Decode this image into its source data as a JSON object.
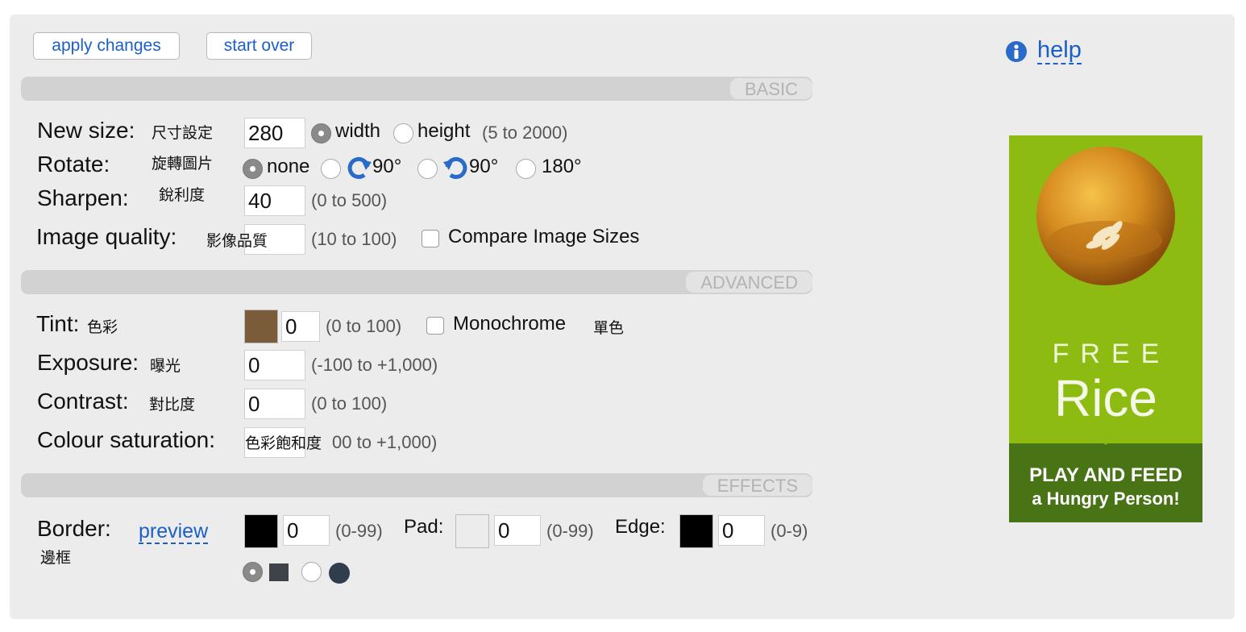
{
  "toolbar": {
    "apply_label": "apply changes",
    "start_over_label": "start over"
  },
  "help": {
    "label": "help",
    "icon": "info-icon"
  },
  "sections": {
    "basic": "BASIC",
    "advanced": "ADVANCED",
    "effects": "EFFECTS"
  },
  "basic": {
    "new_size": {
      "label": "New size:",
      "cjk": "尺寸設定",
      "value": "280",
      "opt_width": "width",
      "opt_height": "height",
      "range": "(5 to 2000)",
      "selected": "width"
    },
    "rotate": {
      "label": "Rotate:",
      "cjk": "旋轉圖片",
      "opt_none": "none",
      "opt_cw": "90°",
      "opt_ccw": "90°",
      "opt_180": "180°",
      "selected": "none"
    },
    "sharpen": {
      "label": "Sharpen:",
      "cjk": "銳利度",
      "value": "40",
      "range": "(0 to 500)"
    },
    "quality": {
      "label": "Image quality:",
      "cjk": "影像品質",
      "range": "(10 to 100)",
      "compare_label": "Compare Image Sizes",
      "compare_checked": false
    }
  },
  "advanced": {
    "tint": {
      "label": "Tint:",
      "cjk": "色彩",
      "color": "#7b5c3a",
      "value": "0",
      "range": "(0 to 100)",
      "mono_label": "Monochrome",
      "mono_cjk": "單色",
      "mono_checked": false
    },
    "exposure": {
      "label": "Exposure:",
      "cjk": "曝光",
      "value": "0",
      "range": "(-100 to +1,000)"
    },
    "contrast": {
      "label": "Contrast:",
      "cjk": "對比度",
      "value": "0",
      "range": "(0 to 100)"
    },
    "saturation": {
      "label": "Colour saturation:",
      "cjk": "色彩飽和度",
      "range": "00 to +1,000)"
    }
  },
  "effects": {
    "border": {
      "label": "Border:",
      "cjk": "邊框",
      "preview_label": "preview",
      "color": "#000000",
      "value": "0",
      "range": "(0-99)",
      "shape_selected": "square"
    },
    "pad": {
      "label": "Pad:",
      "color": "#ececec",
      "value": "0",
      "range": "(0-99)"
    },
    "edge": {
      "label": "Edge:",
      "color": "#000000",
      "value": "0",
      "range": "(0-9)"
    }
  },
  "ad": {
    "line1": "FREE",
    "line2": "Rice",
    "line3": "PLAY AND FEED",
    "line4": "a Hungry Person!"
  },
  "colors": {
    "accent": "#1b5fc7",
    "panel": "#ececec",
    "ad_green": "#8dbb12",
    "ad_dark": "#487416"
  }
}
